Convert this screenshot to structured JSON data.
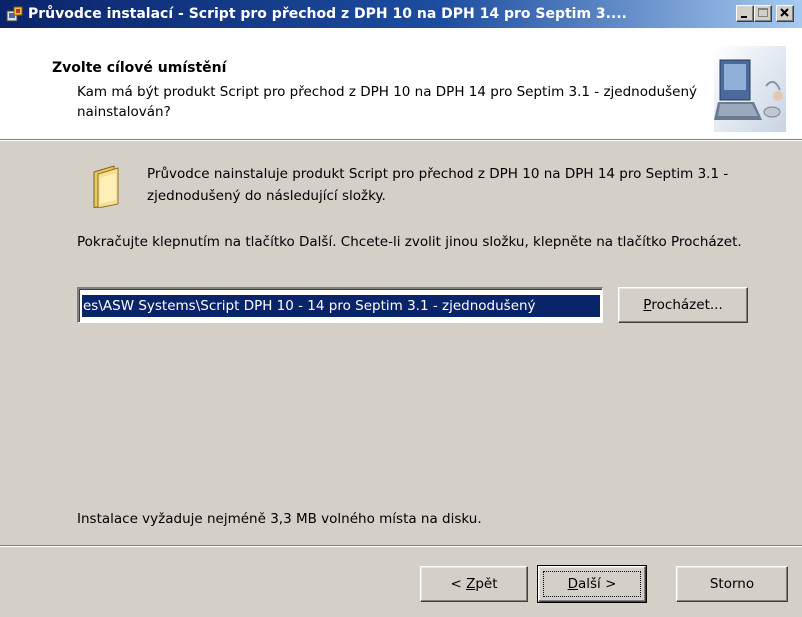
{
  "window": {
    "title": "Průvodce instalací - Script pro přechod z DPH 10 na DPH 14 pro Septim 3....",
    "title_icon": "setup-icon",
    "controls": {
      "minimize": "minimize-icon",
      "maximize": "maximize-icon",
      "close": "close-icon"
    }
  },
  "header": {
    "title": "Zvolte cílové umístění",
    "subtitle": "Kam má být produkt Script pro přechod z DPH 10 na DPH 14 pro Septim 3.1 - zjednodušený nainstalován?",
    "image": "installer-computer-image"
  },
  "body": {
    "intro": "Průvodce nainstaluje produkt Script pro přechod z DPH 10 na DPH 14 pro Septim 3.1 - zjednodušený do následující složky.",
    "instruction": "Pokračujte klepnutím na tlačítko Další. Chcete-li zvolit jinou složku, klepněte na tlačítko Procházet.",
    "path_value": "es\\ASW Systems\\Script DPH 10 - 14 pro Septim 3.1 - zjednodušený",
    "browse_label_mnemonic": "P",
    "browse_label_rest": "rocházet...",
    "space_required": "Instalace vyžaduje nejméně 3,3 MB volného místa na disku.",
    "folder_icon": "folder-icon"
  },
  "footer": {
    "back_prefix": "< ",
    "back_mnemonic": "Z",
    "back_rest": "pět",
    "next_mnemonic": "D",
    "next_rest": "alší >",
    "cancel_label": "Storno"
  },
  "colors": {
    "titlebar_start": "#0a246a",
    "titlebar_end": "#a6caf0",
    "dialog_face": "#d4d0c8",
    "selection": "#0a246a"
  }
}
